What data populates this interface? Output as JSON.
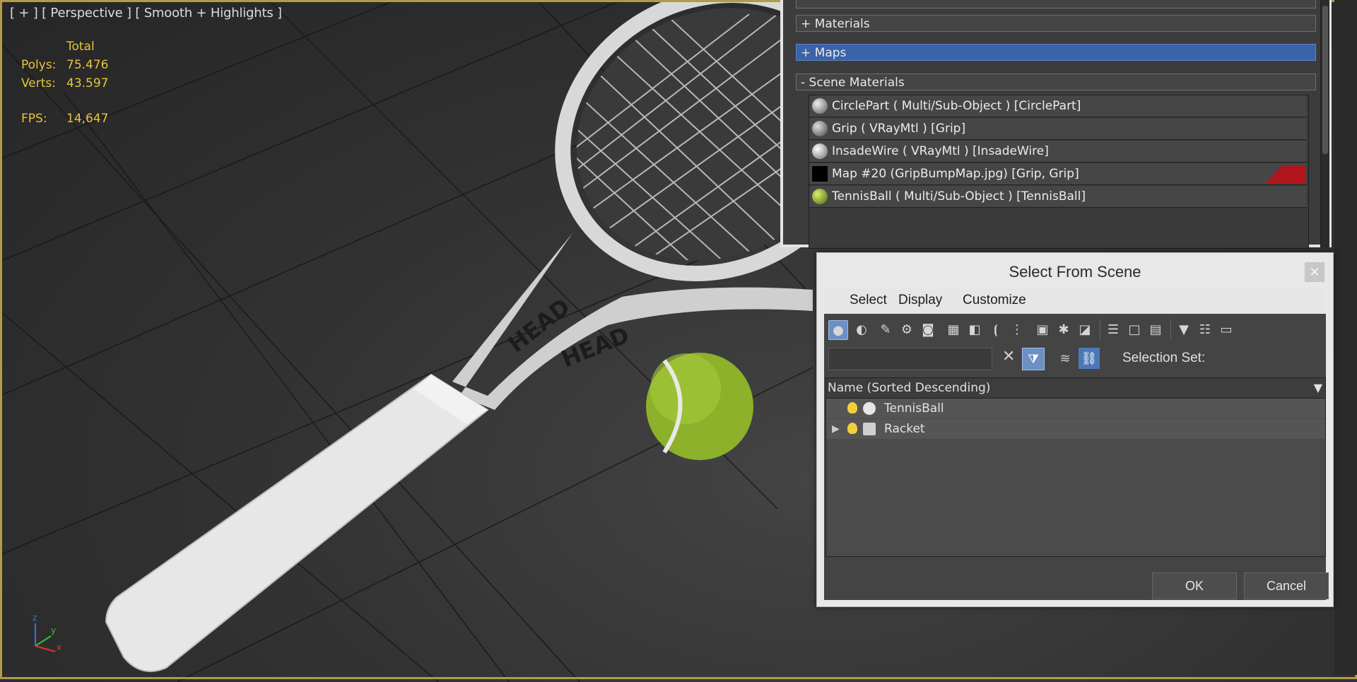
{
  "viewport": {
    "label": "[ + ] [ Perspective ] [ Smooth + Highlights ]",
    "stats": {
      "header": "Total",
      "polys_label": "Polys:",
      "polys_value": "75.476",
      "verts_label": "Verts:",
      "verts_value": "43.597",
      "fps_label": "FPS:",
      "fps_value": "14,647"
    },
    "racket_text": "HEAD",
    "gizmo": {
      "z": "z",
      "y": "y",
      "x": "x"
    }
  },
  "material_panel": {
    "rollouts": [
      "+ Materials",
      "+ Maps",
      "- Scene Materials"
    ],
    "items": [
      {
        "name": "CirclePart  ( Multi/Sub-Object )  [CirclePart]",
        "swatch": "#8a8a8a"
      },
      {
        "name": "Grip  ( VRayMtl )  [Grip]",
        "swatch": "#7a7a7a"
      },
      {
        "name": "InsadeWire  ( VRayMtl )  [InsadeWire]",
        "swatch": "#9a9a9a"
      },
      {
        "name": "Map #20 (GripBumpMap.jpg) [Grip, Grip]",
        "swatch": "#000000"
      },
      {
        "name": "TennisBall  ( Multi/Sub-Object )  [TennisBall]",
        "swatch": "#8fae2e"
      }
    ]
  },
  "dialog": {
    "title": "Select From Scene",
    "close": "×",
    "menu": [
      "Select",
      "Display",
      "Customize"
    ],
    "selection_set_label": "Selection Set:",
    "column_header": "Name (Sorted Descending)",
    "rows": [
      {
        "name": "TennisBall",
        "expander": ""
      },
      {
        "name": "Racket",
        "expander": "▶"
      }
    ],
    "ok": "OK",
    "cancel": "Cancel"
  },
  "colors": {
    "viewport_border": "#b39a47",
    "stats_text": "#e6c53a",
    "maps_highlight": "#3a63a8",
    "red_tag": "#b0151b"
  }
}
